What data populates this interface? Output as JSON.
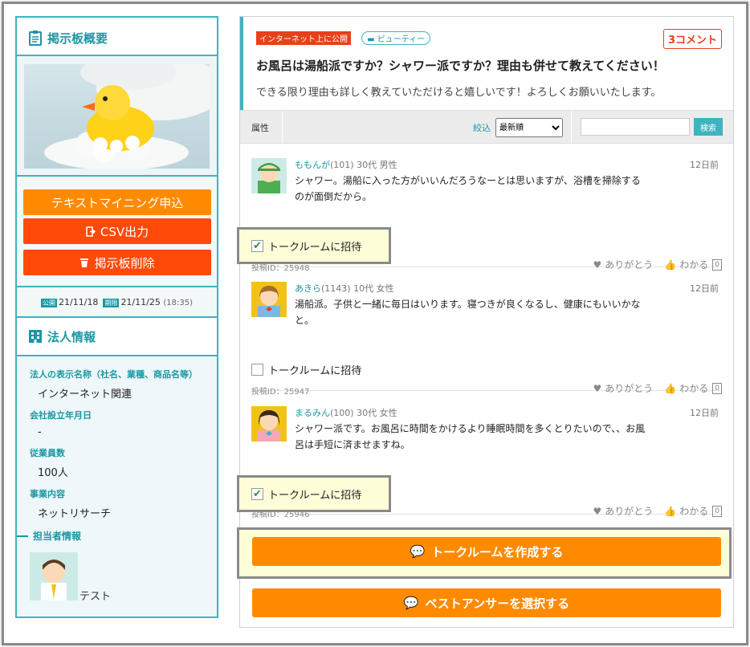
{
  "sidebar": {
    "board_title": "掲示板概要",
    "buttons": {
      "text_mining": "テキストマイニング申込",
      "csv": "CSV出力",
      "delete": "掲示板削除"
    },
    "dates": {
      "open_tag": "公開",
      "open_date": "21/11/18",
      "end_tag": "期限",
      "end_date": "21/11/25",
      "end_time": "(18:35)"
    },
    "corp_title": "法人情報",
    "fields": [
      {
        "label": "法人の表示名称（社名、業種、商品名等）",
        "value": "インターネット関連"
      },
      {
        "label": "会社設立年月日",
        "value": "-"
      },
      {
        "label": "従業員数",
        "value": "100人"
      },
      {
        "label": "事業内容",
        "value": "ネットリサーチ"
      }
    ],
    "contact_title": "担当者情報",
    "contact_name": "テスト"
  },
  "question": {
    "scope_badge": "インターネット上に公開",
    "category": "ビューティー",
    "comment_count": "3コメント",
    "title": "お風呂は湯船派ですか？シャワー派ですか？理由も併せて教えてください！",
    "body": "できる限り理由も詳しく教えていただけると嬉しいです！よろしくお願いいたします。"
  },
  "filter": {
    "attribute_label": "属性",
    "narrow_label": "絞込",
    "sort_selected": "最新順",
    "search_placeholder": "",
    "search_button": "検索"
  },
  "posts": [
    {
      "name": "ももんが",
      "meta": "(101) 30代 男性",
      "time": "12日前",
      "text": "シャワー。湯船に入った方がいいんだろうなーとは思いますが、浴槽を掃除するのが面倒だから。",
      "invite": "トークルームに招待",
      "invited": true,
      "post_id": "投稿ID：25948",
      "thanks": "ありがとう",
      "agree": "わかる",
      "agree_count": "0",
      "avatar_color": "#4caf50"
    },
    {
      "name": "あきら",
      "meta": "(1143) 10代 女性",
      "time": "12日前",
      "text": "湯船派。子供と一緒に毎日はいります。寝つきが良くなるし、健康にもいいかなと。",
      "invite": "トークルームに招待",
      "invited": false,
      "post_id": "投稿ID：25947",
      "thanks": "ありがとう",
      "agree": "わかる",
      "agree_count": "0",
      "avatar_color": "#f2c21b"
    },
    {
      "name": "まるみん",
      "meta": "(100) 30代 女性",
      "time": "12日前",
      "text": "シャワー派です。お風呂に時間をかけるより睡眠時間を多くとりたいので、、お風呂は手短に済ませますね。",
      "invite": "トークルームに招待",
      "invited": true,
      "post_id": "投稿ID：25946",
      "thanks": "ありがとう",
      "agree": "わかる",
      "agree_count": "0",
      "avatar_color": "#f7a6b8"
    }
  ],
  "actions": {
    "create_talkroom": "トークルームを作成する",
    "best_answer": "ベストアンサーを選択する"
  },
  "colors": {
    "teal": "#3db4bf",
    "orange": "#ff8a00",
    "red_orange": "#ff4a0a",
    "highlight": "#fdfdd8"
  }
}
